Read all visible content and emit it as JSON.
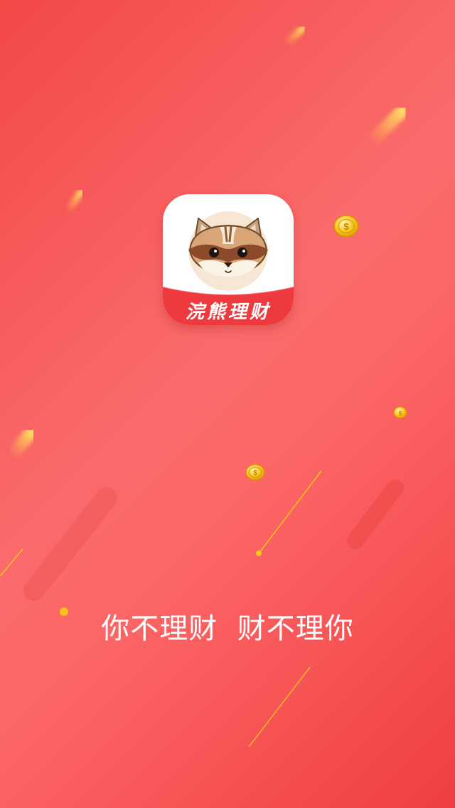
{
  "app": {
    "name": "浣熊理财",
    "icon": "raccoon-mascot-icon"
  },
  "slogan": "你不理财  财不理你",
  "colors": {
    "background_start": "#f24848",
    "background_mid": "#fb6b6b",
    "background_end": "#f03e42",
    "icon_banner": "#ee3a3f",
    "coin_gold": "#f7c21a",
    "accent_line": "#f5c518"
  }
}
